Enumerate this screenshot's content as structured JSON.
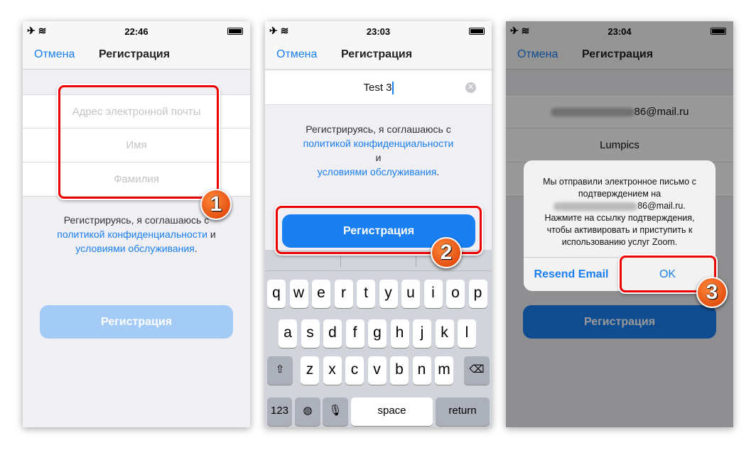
{
  "colors": {
    "accent": "#1a7ff0",
    "callout": "#e00000"
  },
  "screens": [
    {
      "time": "22:46",
      "cancel": "Отмена",
      "title": "Регистрация",
      "fields": [
        {
          "placeholder": "Адрес электронной почты"
        },
        {
          "placeholder": "Имя"
        },
        {
          "placeholder": "Фамилия"
        }
      ],
      "consent": {
        "text": "Регистрируясь, я соглашаюсь с",
        "link1": "политикой конфиденциальности",
        "and": "и",
        "link2": "условиями обслуживания",
        "end": "."
      },
      "button": "Регистрация",
      "step": "1"
    },
    {
      "time": "23:03",
      "cancel": "Отмена",
      "title": "Регистрация",
      "field_value": "Test 3",
      "consent": {
        "text": "Регистрируясь, я соглашаюсь с",
        "link1": "политикой конфиденциальности",
        "and": "и",
        "link2": "условиями обслуживания",
        "end": "."
      },
      "button": "Регистрация",
      "step": "2",
      "keyboard": {
        "row1": [
          "q",
          "w",
          "e",
          "r",
          "t",
          "y",
          "u",
          "i",
          "o",
          "p"
        ],
        "row2": [
          "a",
          "s",
          "d",
          "f",
          "g",
          "h",
          "j",
          "k",
          "l"
        ],
        "row3": [
          "z",
          "x",
          "c",
          "v",
          "b",
          "n",
          "m"
        ],
        "num": "123",
        "space": "space",
        "return": "return"
      }
    },
    {
      "time": "23:04",
      "cancel": "Отмена",
      "title": "Регистрация",
      "email_suffix": "86@mail.ru",
      "name": "Lumpics",
      "button": "Регистрация",
      "step": "3",
      "dialog": {
        "line1": "Мы отправили электронное письмо с подтверждением на",
        "email_suffix": "86@mail.ru.",
        "line2": "Нажмите на ссылку подтверждения, чтобы активировать и приступить к использованию услуг Zoom.",
        "resend": "Resend Email",
        "ok": "OK"
      }
    }
  ]
}
